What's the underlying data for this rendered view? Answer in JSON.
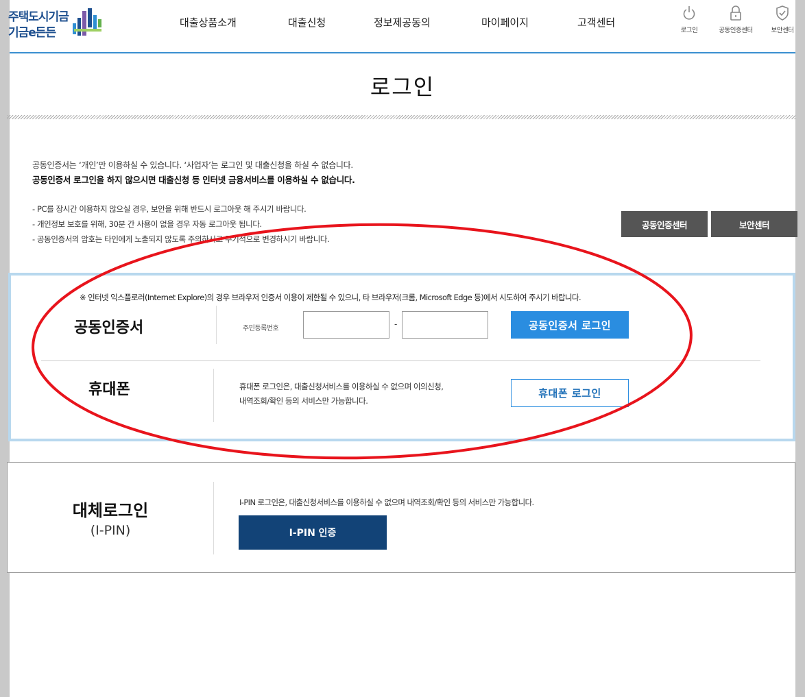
{
  "header": {
    "logo_line1": "주택도시기금",
    "logo_line2": "기금e든든",
    "nav": [
      {
        "label": "대출상품소개"
      },
      {
        "label": "대출신청"
      },
      {
        "label": "정보제공동의"
      },
      {
        "label": "마이페이지"
      },
      {
        "label": "고객센터"
      }
    ],
    "utils": [
      {
        "label": "로그인",
        "icon": "power-icon"
      },
      {
        "label": "공동인증센터",
        "icon": "lock-icon"
      },
      {
        "label": "보안센터",
        "icon": "shield-icon"
      }
    ]
  },
  "page": {
    "title": "로그인"
  },
  "notice": {
    "line1": "공동인증서는 ‘개인’만 이용하실 수 있습니다. ‘사업자’는 로그인 및 대출신청을 하실 수 없습니다.",
    "line2": "공동인증서 로그인을 하지 않으시면 대출신청 등 인터넷 금융서비스를 이용하실 수 없습니다.",
    "bullets": [
      "- PC를 장시간 이용하지 않으실 경우, 보안을 위해 반드시 로그아웃 해 주시기 바랍니다.",
      "- 개인정보 보호를 위해, 30분 간 사용이 없을 경우 자동 로그아웃 됩니다.",
      "- 공동인증서의 암호는 타인에게 노출되지 않도록 주의하시고 주기적으로 변경하시기 바랍니다."
    ]
  },
  "side_buttons": {
    "cert_center": "공동인증센터",
    "security_center": "보안센터"
  },
  "cert_login": {
    "browser_note": "※ 인터넷 익스플로러(Internet Explore)의 경우 브라우저 인증서 이용이 제한될 수 있으니, 타 브라우저(크롬, Microsoft Edge 등)에서 시도하여 주시기 바랍니다.",
    "label": "공동인증서",
    "rrn_label": "주민등록번호",
    "rrn_front": "",
    "rrn_back": "",
    "dash": "-",
    "button": "공동인증서 로그인"
  },
  "phone_login": {
    "label": "휴대폰",
    "desc_line1": "휴대폰 로그인은, 대출신청서비스를 이용하실 수 없으며 이의신청,",
    "desc_line2": "내역조회/확인 등의 서비스만 가능합니다.",
    "button": "휴대폰 로그인"
  },
  "alt_login": {
    "title": "대체로그인",
    "subtitle": "(I-PIN)",
    "desc": "I-PIN 로그인은, 대출신청서비스를 이용하실 수 없으며 내역조회/확인 등의 서비스만 가능합니다.",
    "button": "I-PIN 인증"
  },
  "colors": {
    "header_rule": "#3a8fd0",
    "primary_blue": "#2a8de0",
    "navy": "#124377",
    "dark_button": "#555555",
    "highlight_border": "#b8d8ee",
    "annotation_red": "#e8141c"
  }
}
